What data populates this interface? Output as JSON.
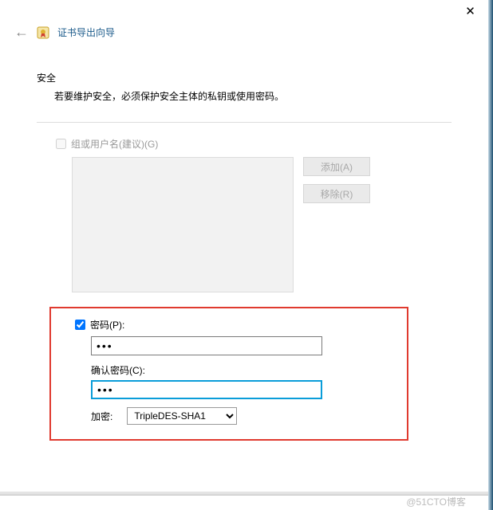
{
  "titlebar": {
    "close_glyph": "✕"
  },
  "header": {
    "back_glyph": "←",
    "title": "证书导出向导"
  },
  "section": {
    "heading": "安全",
    "desc": "若要维护安全，必须保护安全主体的私钥或使用密码。"
  },
  "group_users": {
    "checkbox_label": "组或用户名(建议)(G)",
    "checked": false,
    "add_btn": "添加(A)",
    "remove_btn": "移除(R)"
  },
  "password": {
    "checkbox_label": "密码(P):",
    "checked": true,
    "value": "•••",
    "confirm_label": "确认密码(C):",
    "confirm_value": "•••"
  },
  "encryption": {
    "label": "加密:",
    "selected": "TripleDES-SHA1",
    "options": [
      "TripleDES-SHA1"
    ]
  },
  "watermark": "@51CTO博客"
}
